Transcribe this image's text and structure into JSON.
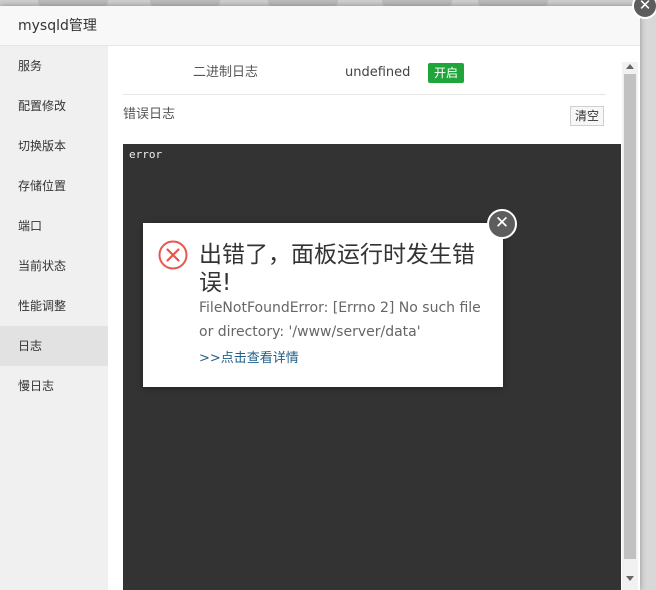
{
  "window": {
    "title": "mysqld管理",
    "close_glyph": "✕"
  },
  "sidebar": {
    "items": [
      {
        "label": "服务"
      },
      {
        "label": "配置修改"
      },
      {
        "label": "切换版本"
      },
      {
        "label": "存储位置"
      },
      {
        "label": "端口"
      },
      {
        "label": "当前状态"
      },
      {
        "label": "性能调整"
      },
      {
        "label": "日志",
        "active": true
      },
      {
        "label": "慢日志"
      }
    ]
  },
  "logs": {
    "binlog_label": "二进制日志",
    "binlog_value": "undefined",
    "binlog_badge": "开启",
    "error_log_label": "错误日志",
    "clear_label": "清空",
    "error_log_content": "error"
  },
  "dialog": {
    "title": "出错了，面板运行时发生错误!",
    "message": "FileNotFoundError: [Errno 2] No such file or directory: '/www/server/data'",
    "detail_link": ">>点击查看详情",
    "close_glyph": "✕",
    "icon": "error-x-circle-icon"
  },
  "colors": {
    "accent_green": "#20a53a",
    "error_red": "#e6574c",
    "link_blue": "#20608a",
    "log_bg": "#333333"
  }
}
